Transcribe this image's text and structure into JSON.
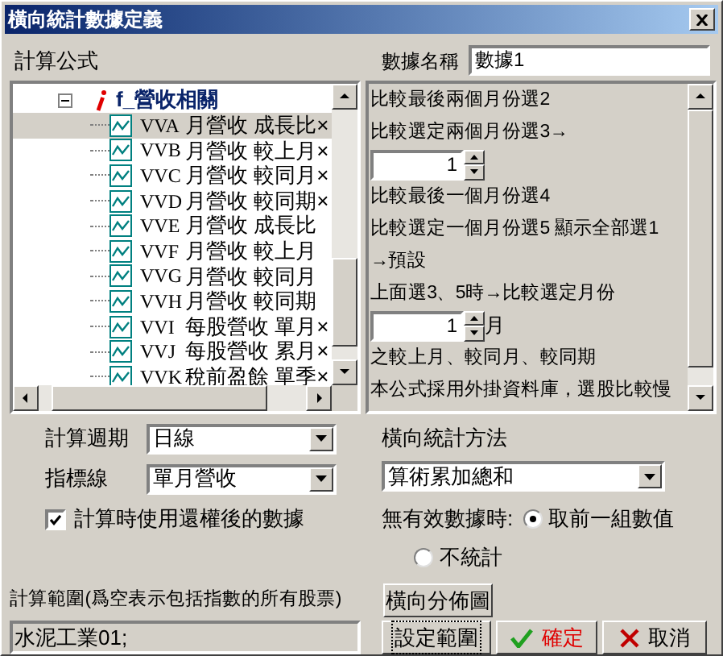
{
  "window": {
    "title": "橫向統計數據定義"
  },
  "formula_label": "計算公式",
  "tree": {
    "label": "f_營收相關",
    "expanded": true,
    "children": [
      {
        "code": "VVA",
        "label": "月營收 成長比×",
        "selected": true
      },
      {
        "code": "VVB",
        "label": "月營收 較上月×",
        "selected": false
      },
      {
        "code": "VVC",
        "label": "月營收 較同月×",
        "selected": false
      },
      {
        "code": "VVD",
        "label": "月營收 較同期×",
        "selected": false
      },
      {
        "code": "VVE",
        "label": "月營收 成長比",
        "selected": false
      },
      {
        "code": "VVF",
        "label": "月營收 較上月",
        "selected": false
      },
      {
        "code": "VVG",
        "label": "月營收 較同月",
        "selected": false
      },
      {
        "code": "VVH",
        "label": "月營收 較同期",
        "selected": false
      },
      {
        "code": "VVI",
        "label": "每股營收 單月×",
        "selected": false
      },
      {
        "code": "VVJ",
        "label": "每股營收 累月×",
        "selected": false
      },
      {
        "code": "VVK",
        "label": "稅前盈餘 單季×",
        "selected": false
      }
    ]
  },
  "name_field": {
    "label": "數據名稱",
    "value": "數據1"
  },
  "description": [
    {
      "kind": "text",
      "text": "比較最後兩個月份選2"
    },
    {
      "kind": "text",
      "text": "比較選定兩個月份選3→"
    },
    {
      "kind": "spin",
      "value": "1"
    },
    {
      "kind": "text",
      "text": "比較最後一個月份選4"
    },
    {
      "kind": "text",
      "text": "比較選定一個月份選5 顯示全部選1"
    },
    {
      "kind": "text",
      "text": "→預設"
    },
    {
      "kind": "text",
      "text": "上面選3、5時→比較選定月份"
    },
    {
      "kind": "spin",
      "value": "1",
      "unit": "月"
    },
    {
      "kind": "text",
      "text": "之較上月、較同月、較同期"
    },
    {
      "kind": "text",
      "text": "本公式採用外掛資料庫，選股比較慢"
    }
  ],
  "period": {
    "label": "計算週期",
    "value": "日線"
  },
  "indicator": {
    "label": "指標線",
    "value": "單月營收"
  },
  "adjusted": {
    "label": "計算時使用還權後的數據",
    "checked": true
  },
  "method": {
    "label": "橫向統計方法",
    "value": "算術累加總和"
  },
  "invalid": {
    "label": "無有效數據時:",
    "options": [
      {
        "label": "取前一組數值",
        "selected": true
      },
      {
        "label": "不統計",
        "selected": false
      }
    ]
  },
  "range": {
    "label": "計算範圍(爲空表示包括指數的所有股票)",
    "value": "水泥工業01;"
  },
  "buttons": [
    {
      "kind": "distribution",
      "label": "橫向分佈圖"
    },
    {
      "kind": "range",
      "label": "設定範圍",
      "focused": true
    },
    {
      "kind": "ok",
      "label": "確定"
    },
    {
      "kind": "cancel",
      "label": "取消"
    }
  ]
}
